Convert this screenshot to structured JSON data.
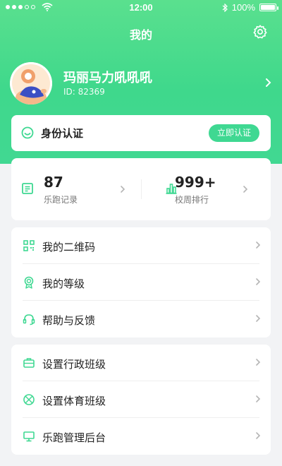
{
  "status": {
    "time": "12:00",
    "battery": "100%",
    "battery_level": 1.0
  },
  "header": {
    "title": "我的"
  },
  "profile": {
    "name": "玛丽马力吼吼吼",
    "id": "ID: 82369"
  },
  "identity": {
    "title": "身份认证",
    "action": "立即认证"
  },
  "stats": [
    {
      "value": "87",
      "label": "乐跑记录",
      "icon": "clipboard-icon"
    },
    {
      "value": "999+",
      "label": "校周排行",
      "icon": "bar-chart-icon"
    }
  ],
  "menu_group_1": [
    {
      "label": "我的二维码",
      "icon": "qrcode-icon"
    },
    {
      "label": "我的等级",
      "icon": "medal-icon"
    },
    {
      "label": "帮助与反馈",
      "icon": "headset-icon"
    }
  ],
  "menu_group_2": [
    {
      "label": "设置行政班级",
      "icon": "briefcase-icon"
    },
    {
      "label": "设置体育班级",
      "icon": "basketball-icon"
    },
    {
      "label": "乐跑管理后台",
      "icon": "monitor-icon"
    }
  ],
  "colors": {
    "primary": "#3fd892",
    "text": "#222222",
    "muted": "#777777",
    "background": "#f2f3f5"
  }
}
